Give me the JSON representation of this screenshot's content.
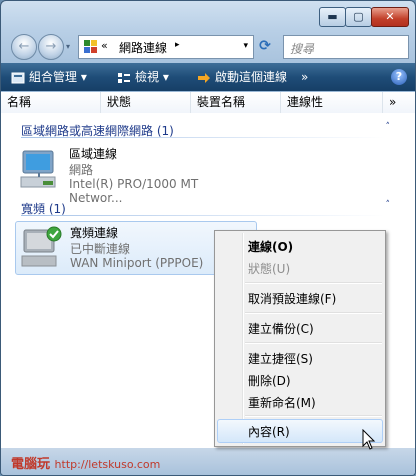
{
  "titlebar": {
    "minimize": "▬",
    "maximize": "▢",
    "close": "✕"
  },
  "address": {
    "chevrons": "«",
    "crumb": "網路連線",
    "arrow": "▸",
    "dropdown": "▾"
  },
  "search": {
    "placeholder": "搜尋"
  },
  "toolbar": {
    "organize": "組合管理",
    "views": "檢視",
    "start": "啟動這個連線",
    "more": "»",
    "help": "?"
  },
  "columns": [
    "名稱",
    "狀態",
    "裝置名稱",
    "連線性",
    "»"
  ],
  "groups": [
    {
      "title": "區域網路或高速網際網路 (1)",
      "collapse": "˄"
    },
    {
      "title": "寬頻 (1)",
      "collapse": "˄"
    }
  ],
  "items": [
    {
      "name": "區域連線",
      "status": "網路",
      "device": "Intel(R) PRO/1000 MT Networ..."
    },
    {
      "name": "寬頻連線",
      "status": "已中斷連線",
      "device": "WAN Miniport (PPPOE)"
    }
  ],
  "context_menu": {
    "connect": "連線(O)",
    "status": "狀態(U)",
    "cancel_default": "取消預設連線(F)",
    "create_copy": "建立備份(C)",
    "create_shortcut": "建立捷徑(S)",
    "delete": "刪除(D)",
    "rename": "重新命名(M)",
    "properties": "內容(R)"
  },
  "watermark": {
    "brand": "電腦玩",
    "url": "http://letskuso.com"
  }
}
